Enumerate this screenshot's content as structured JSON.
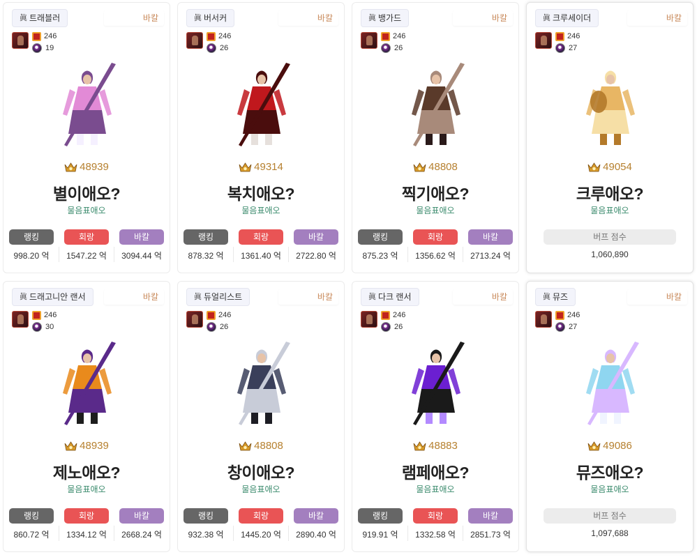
{
  "cards": [
    {
      "job": "트래블러",
      "server": "바칼",
      "level": "246",
      "set": "19",
      "fame": "48939",
      "name": "별이애오?",
      "guild": "물음표애오",
      "kind": "dealer",
      "labels": [
        "랭킹",
        "회랑",
        "바칼"
      ],
      "values": [
        "998.20 억",
        "1547.22 억",
        "3094.44 억"
      ],
      "palette": [
        "#e28ad6",
        "#7a4c8f",
        "#f5f0ff"
      ]
    },
    {
      "job": "버서커",
      "server": "바칼",
      "level": "246",
      "set": "26",
      "fame": "49314",
      "name": "복치애오?",
      "guild": "물음표애오",
      "kind": "dealer",
      "labels": [
        "랭킹",
        "회랑",
        "바칼"
      ],
      "values": [
        "878.32 억",
        "1361.40 억",
        "2722.80 억"
      ],
      "palette": [
        "#c0181d",
        "#4a0d0d",
        "#e6e0dc"
      ]
    },
    {
      "job": "뱅가드",
      "server": "바칼",
      "level": "246",
      "set": "26",
      "fame": "48808",
      "name": "찍기애오?",
      "guild": "물음표애오",
      "kind": "dealer",
      "labels": [
        "랭킹",
        "회랑",
        "바칼"
      ],
      "values": [
        "875.23 억",
        "1356.62 억",
        "2713.24 억"
      ],
      "palette": [
        "#5a3a2a",
        "#a88a7a",
        "#2a1a1a"
      ]
    },
    {
      "job": "크루세이더",
      "server": "바칼",
      "level": "246",
      "set": "27",
      "fame": "49054",
      "name": "크루애오?",
      "guild": "물음표애오",
      "kind": "buffer",
      "buff_label": "버프 점수",
      "buff_value": "1,060,890",
      "palette": [
        "#e8b664",
        "#f6dfa6",
        "#b47a2a"
      ]
    },
    {
      "job": "드래고니안 랜서",
      "server": "바칼",
      "level": "246",
      "set": "30",
      "fame": "48939",
      "name": "제노애오?",
      "guild": "물음표애오",
      "kind": "dealer",
      "labels": [
        "랭킹",
        "회랑",
        "바칼"
      ],
      "values": [
        "860.72 억",
        "1334.12 억",
        "2668.24 억"
      ],
      "palette": [
        "#e98a1c",
        "#5a2a8a",
        "#1d1d1d"
      ]
    },
    {
      "job": "듀얼리스트",
      "server": "바칼",
      "level": "246",
      "set": "26",
      "fame": "48808",
      "name": "창이애오?",
      "guild": "물음표애오",
      "kind": "dealer",
      "labels": [
        "랭킹",
        "회랑",
        "바칼"
      ],
      "values": [
        "932.38 억",
        "1445.20 억",
        "2890.40 억"
      ],
      "palette": [
        "#3a3f5a",
        "#c8ccd8",
        "#1d1d24"
      ]
    },
    {
      "job": "다크 랜서",
      "server": "바칼",
      "level": "246",
      "set": "26",
      "fame": "48883",
      "name": "램페애오?",
      "guild": "물음표애오",
      "kind": "dealer",
      "labels": [
        "랭킹",
        "회랑",
        "바칼"
      ],
      "values": [
        "919.91 억",
        "1332.58 억",
        "2851.73 억"
      ],
      "palette": [
        "#6b1fd1",
        "#1a1a1a",
        "#b38aff"
      ]
    },
    {
      "job": "뮤즈",
      "server": "바칼",
      "level": "246",
      "set": "27",
      "fame": "49086",
      "name": "뮤즈애오?",
      "guild": "물음표애오",
      "kind": "buffer",
      "buff_label": "버프 점수",
      "buff_value": "1,097,688",
      "palette": [
        "#8fd6f0",
        "#d8b8ff",
        "#f0f4ff"
      ]
    }
  ],
  "icons": {
    "job_prefix": "眞",
    "fame_icon": "fame-crown-icon",
    "level_icon": "level-emblem-icon",
    "set_icon": "set-orb-icon",
    "avatar": "character-avatar-icon"
  }
}
